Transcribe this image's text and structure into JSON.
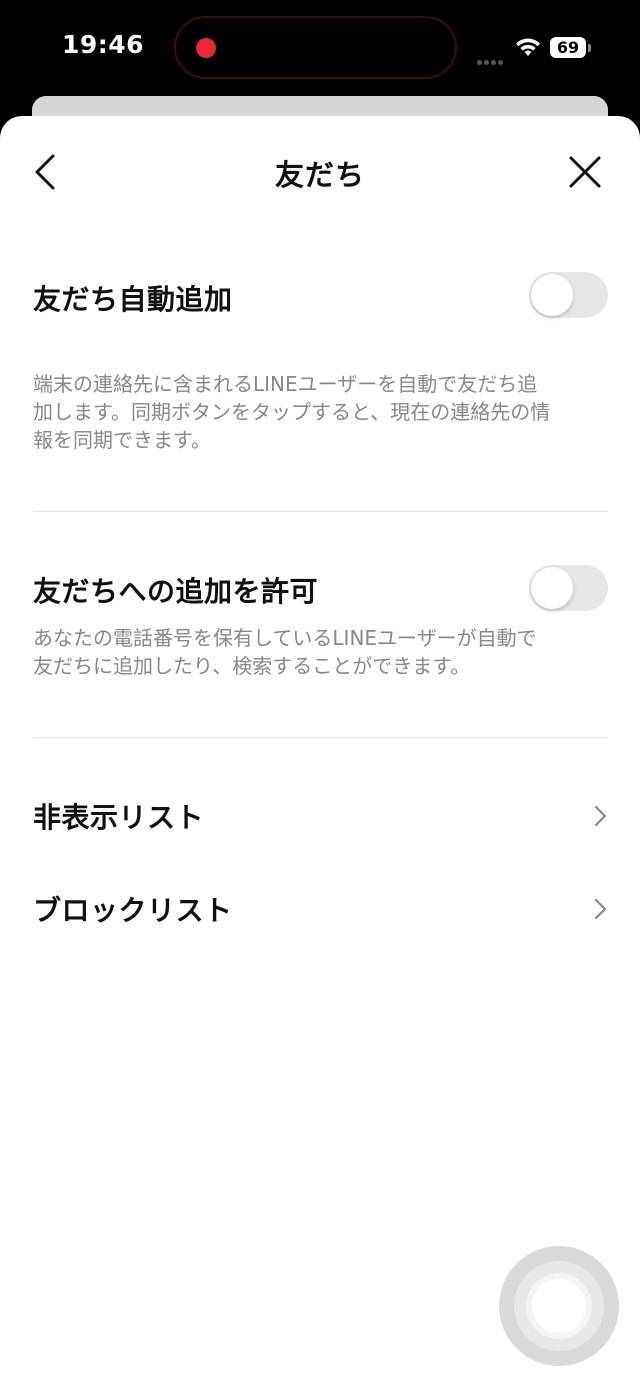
{
  "status_bar": {
    "time": "19:46",
    "battery": "69",
    "icons": [
      "recording-dot",
      "signal-dots",
      "wifi-icon",
      "battery-icon"
    ]
  },
  "header": {
    "title": "友だち",
    "back_icon": "chevron-left-icon",
    "close_icon": "close-icon"
  },
  "settings": {
    "auto_add": {
      "title": "友だち自動追加",
      "desc_lines": [
        "端末の連絡先に含まれるLINEユーザーを自動で友だち追",
        "加します。同期ボタンをタップすると、現在の連絡先の情",
        "報を同期できます。"
      ],
      "enabled": false
    },
    "allow_add": {
      "title": "友だちへの追加を許可",
      "desc_lines": [
        "あなたの電話番号を保有しているLINEユーザーが自動で",
        "友だちに追加したり、検索することができます。"
      ],
      "enabled": false
    }
  },
  "nav": {
    "hidden_list": "非表示リスト",
    "block_list": "ブロックリスト"
  },
  "colors": {
    "toggle_off": "#e6e6e8",
    "recording": "#e8283a",
    "text_primary": "#111111",
    "text_secondary": "#888888"
  }
}
